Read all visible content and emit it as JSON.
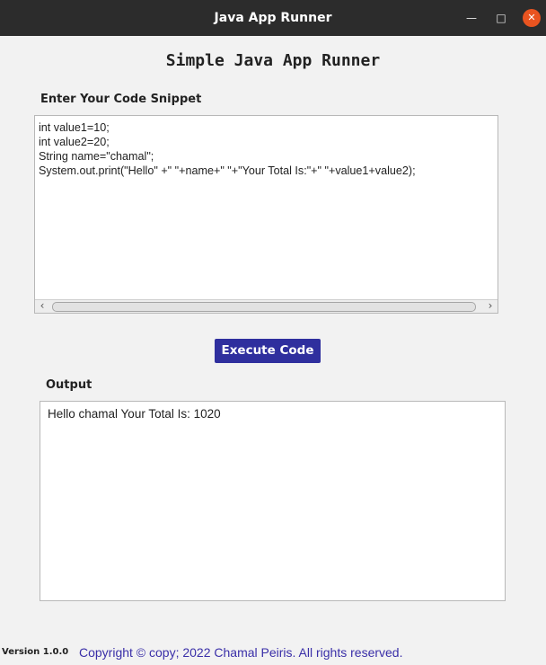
{
  "window": {
    "title": "Java App Runner",
    "minimize_glyph": "—",
    "maximize_glyph": "□",
    "close_glyph": "✕",
    "close_color": "#e95420"
  },
  "app": {
    "heading": "Simple Java App Runner"
  },
  "code_input": {
    "label": "Enter Your Code Snippet",
    "value": "int value1=10;\nint value2=20;\nString name=\"chamal\";\nSystem.out.print(\"Hello\" +\" \"+name+\" \"+\"Your Total Is:\"+\" \"+value1+value2);",
    "scroll_left_glyph": "‹",
    "scroll_right_glyph": "›"
  },
  "execute_button": {
    "label": "Execute Code",
    "color": "#2f2f9e"
  },
  "output": {
    "label": "Output",
    "value": "Hello chamal Your Total Is: 1020"
  },
  "footer": {
    "version": "Version 1.0.0",
    "copyright": "Copyright © copy; 2022 Chamal Peiris. All rights reserved.",
    "copyright_color": "#3a2fa8"
  }
}
